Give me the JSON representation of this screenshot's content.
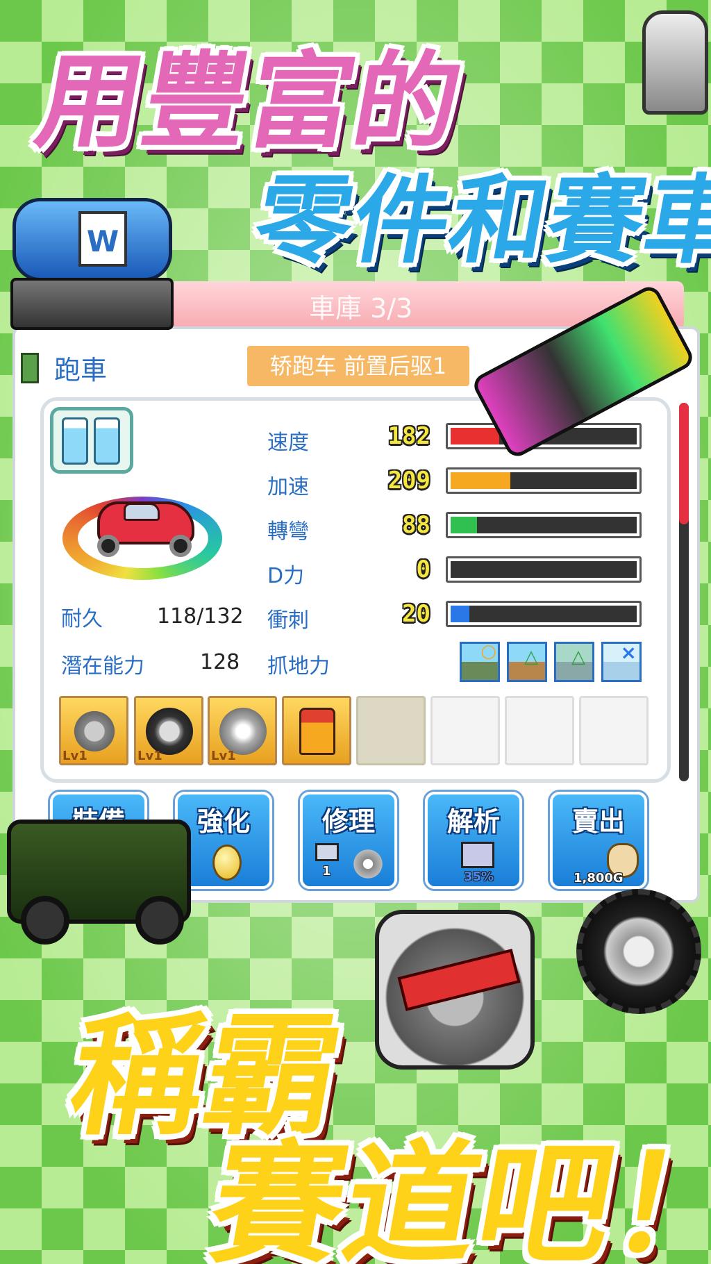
{
  "headline": {
    "line1": "用豐富的",
    "line2": "零件和賽車",
    "line3": "稱霸",
    "line4": "賽道吧！"
  },
  "garage": {
    "banner": "車庫 3/3",
    "car_type": "跑車",
    "car_model": "轿跑车 前置后驱1"
  },
  "stats": [
    {
      "label": "速度",
      "value": "182",
      "level": 0.26,
      "color": "#e83030"
    },
    {
      "label": "加速",
      "value": "209",
      "level": 0.32,
      "color": "#f5a820"
    },
    {
      "label": "轉彎",
      "value": "88",
      "level": 0.14,
      "color": "#30c050"
    },
    {
      "label": "D力",
      "value": "0",
      "level": 0.0,
      "color": "#888888"
    },
    {
      "label": "衝刺",
      "value": "20",
      "level": 0.1,
      "color": "#2a78e8"
    }
  ],
  "info": {
    "durability_label": "耐久",
    "durability_value": "118/132",
    "potential_label": "潛在能力",
    "potential_value": "128",
    "grip_label": "抓地力",
    "grip_marks": [
      "○",
      "△",
      "△",
      "×"
    ]
  },
  "parts": [
    {
      "name": "engine",
      "level": "Lv1"
    },
    {
      "name": "tire",
      "level": "Lv1"
    },
    {
      "name": "wheel",
      "level": "Lv1"
    },
    {
      "name": "oil",
      "level": ""
    }
  ],
  "actions": [
    {
      "label": "裝備",
      "sub": ""
    },
    {
      "label": "強化",
      "sub": ""
    },
    {
      "label": "修理",
      "sub": "1"
    },
    {
      "label": "解析",
      "sub": "35%"
    },
    {
      "label": "賣出",
      "sub": "1,800G"
    }
  ],
  "colors": {
    "pink_title": "#e468b8",
    "blue_title": "#2aa8e8",
    "gold_title": "#ffd21a",
    "panel_label": "#2a6ec4",
    "badge": "#f6b865"
  }
}
